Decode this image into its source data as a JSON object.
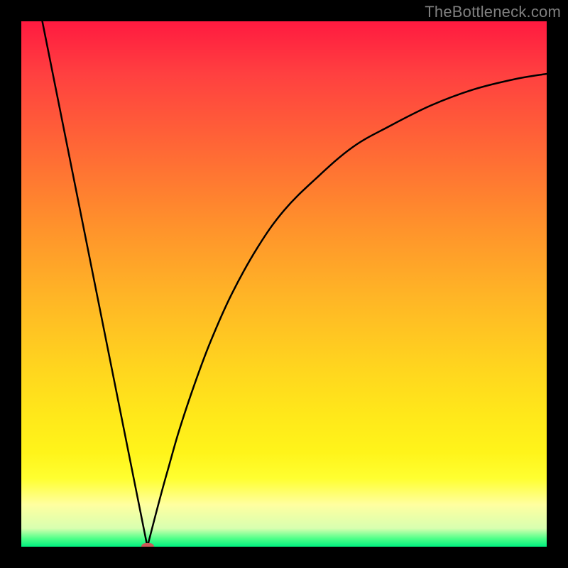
{
  "watermark": "TheBottleneck.com",
  "colors": {
    "curve": "#000000",
    "dot": "#cc5a5a",
    "frame": "#000000"
  },
  "chart_data": {
    "type": "line",
    "title": "",
    "xlabel": "",
    "ylabel": "",
    "xlim": [
      0,
      100
    ],
    "ylim": [
      0,
      100
    ],
    "grid": false,
    "legend": false,
    "annotations": [
      {
        "kind": "marker",
        "x": 24,
        "y": 0,
        "note": "minimum-dot"
      }
    ],
    "series": [
      {
        "name": "left-branch",
        "x": [
          4,
          24
        ],
        "y": [
          100,
          0
        ],
        "note": "straight descending segment from top edge to minimum"
      },
      {
        "name": "right-branch",
        "x": [
          24,
          26,
          28,
          30,
          33,
          36,
          40,
          45,
          50,
          56,
          63,
          70,
          78,
          86,
          94,
          100
        ],
        "y": [
          0,
          8,
          15,
          22,
          31,
          39,
          48,
          57,
          64,
          70,
          76,
          80,
          84,
          87,
          89,
          90
        ],
        "note": "rising curve that decelerates toward the right edge"
      }
    ]
  }
}
